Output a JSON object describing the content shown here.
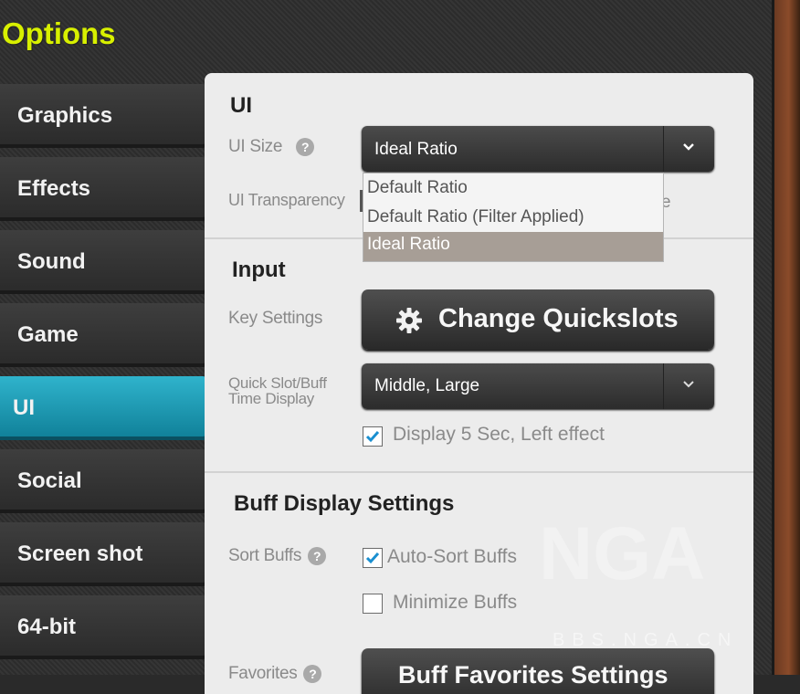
{
  "window": {
    "title": "Options"
  },
  "sidebar": {
    "items": [
      {
        "label": "Graphics"
      },
      {
        "label": "Effects"
      },
      {
        "label": "Sound"
      },
      {
        "label": "Game"
      },
      {
        "label": "UI",
        "active": true
      },
      {
        "label": "Social"
      },
      {
        "label": "Screen shot"
      },
      {
        "label": "64-bit"
      }
    ]
  },
  "ui_section": {
    "title": "UI",
    "ui_size_label": "UI Size",
    "ui_size_value": "Ideal Ratio",
    "ui_transparency_label": "UI Transparency",
    "ui_size_options": [
      "Default Ratio",
      "Default Ratio (Filter Applied)",
      "Ideal Ratio"
    ],
    "hidden_fragment": "e"
  },
  "input_section": {
    "title": "Input",
    "key_settings_label": "Key Settings",
    "change_quickslots_label": "Change Quickslots",
    "quickslot_label_line1": "Quick Slot/Buff",
    "quickslot_label_line2": "Time Display",
    "quickslot_value": "Middle, Large",
    "display_effect_label": "Display 5 Sec, Left effect",
    "display_effect_checked": true
  },
  "buff_section": {
    "title": "Buff Display Settings",
    "sort_buffs_label": "Sort Buffs",
    "auto_sort_label": "Auto-Sort Buffs",
    "auto_sort_checked": true,
    "minimize_label": "Minimize Buffs",
    "minimize_checked": false,
    "favorites_label": "Favorites",
    "favorites_button_label": "Buff Favorites Settings"
  },
  "watermark": {
    "text": "NGA",
    "subtext": "BBS.NGA.CN"
  },
  "colors": {
    "accent": "#1f9bb4",
    "title": "#d8f000"
  },
  "icons": {
    "help": "help-icon",
    "gear": "gear-icon",
    "check": "check-icon",
    "chevron": "chevron-down-icon"
  }
}
